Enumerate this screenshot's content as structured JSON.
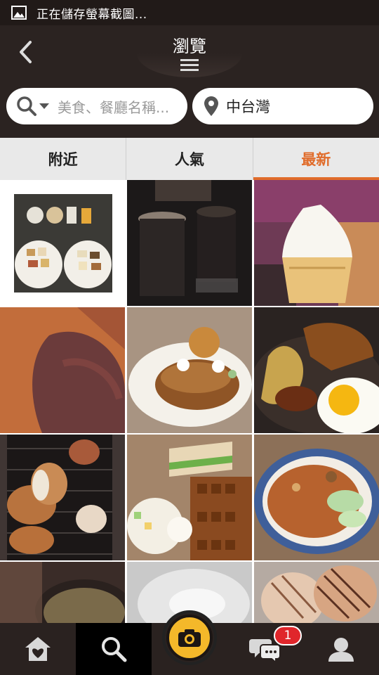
{
  "status_bar": {
    "icon": "gallery-icon",
    "text": "正在儲存螢幕截圖..."
  },
  "header": {
    "title": "瀏覽",
    "back_icon": "chevron-left-icon",
    "menu_icon": "hamburger-menu-icon"
  },
  "search": {
    "placeholder": "美食、餐廳名稱...",
    "location": "中台灣"
  },
  "tabs": [
    {
      "label": "附近",
      "active": false
    },
    {
      "label": "人氣",
      "active": false
    },
    {
      "label": "最新",
      "active": true
    }
  ],
  "grid": [
    "food-platter-photo",
    "dark-drinks-photo",
    "soft-serve-ice-cream-photo",
    "pork-floss-cake-photo",
    "waffle-ice-cream-photo",
    "chicken-noodle-egg-photo",
    "pork-cutlet-photo",
    "sandwich-waffle-platter-photo",
    "rice-bowl-photo",
    "dark-stew-photo",
    "shaved-ice-photo",
    "grilled-sandwich-photo"
  ],
  "bottom_nav": {
    "items": [
      "home-icon",
      "search-icon",
      "camera-icon",
      "chat-icon",
      "profile-icon"
    ],
    "chat_badge": "1"
  },
  "colors": {
    "accent": "#e06c2b",
    "camera": "#f4b82a",
    "badge": "#e0262b"
  }
}
